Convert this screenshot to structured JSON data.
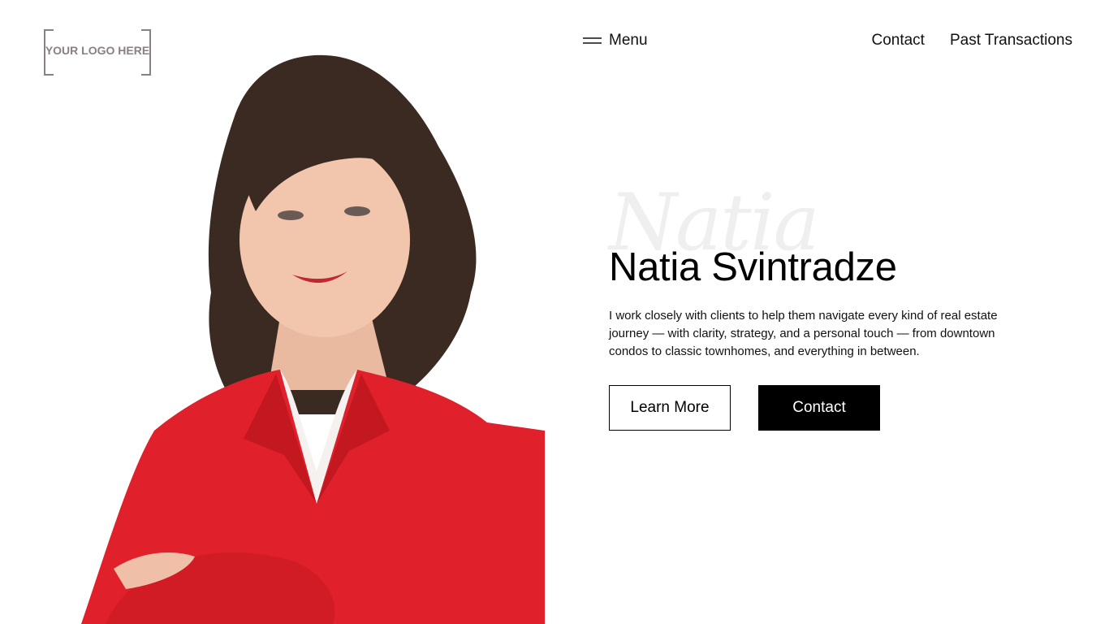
{
  "logo": {
    "text": "YOUR LOGO HERE",
    "color": "#8a7f81"
  },
  "nav": {
    "menu_label": "Menu",
    "menu_icon": "hamburger-icon",
    "links": [
      "Contact",
      "Past Transactions"
    ]
  },
  "hero": {
    "script_name": "Natia",
    "title": "Natia Svintradze",
    "description": "I work closely with clients to help them navigate every kind of real estate journey — with clarity, strategy, and a personal touch — from downtown condos to classic townhomes, and everything in between.",
    "primary_button": "Contact",
    "secondary_button": "Learn More"
  },
  "portrait": {
    "blazer_color": "#e0202b",
    "hair_color": "#3a2a22"
  }
}
